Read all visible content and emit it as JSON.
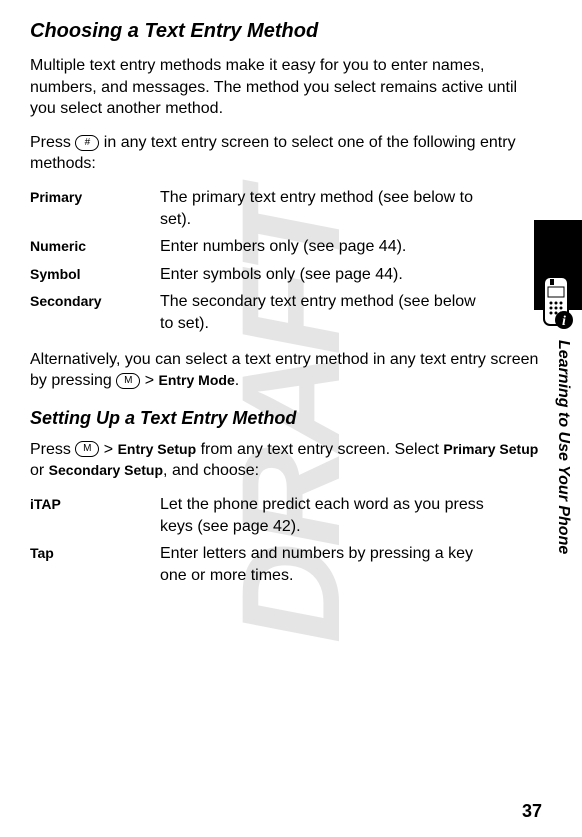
{
  "watermark": "DRAFT",
  "heading_main": "Choosing a Text Entry Method",
  "intro_para": "Multiple text entry methods make it easy for you to enter names, numbers, and messages. The method you select remains active until you select another method.",
  "press_para_pre": "Press ",
  "press_para_post": " in any text entry screen to select one of the following entry methods:",
  "methods": [
    {
      "label": "Primary",
      "desc": "The primary text entry method (see below to set)."
    },
    {
      "label": "Numeric",
      "desc": "Enter numbers only (see page 44)."
    },
    {
      "label": "Symbol",
      "desc": "Enter symbols only (see page 44)."
    },
    {
      "label": "Secondary",
      "desc": "The secondary text entry method (see below to set)."
    }
  ],
  "alt_para_pre": "Alternatively, you can select a text entry method in any text entry screen by pressing ",
  "alt_para_mid": " > ",
  "alt_menu": "Entry Mode",
  "alt_para_post": ".",
  "heading_setup": "Setting Up a Text Entry Method",
  "setup_para_pre": "Press ",
  "setup_para_mid1": " > ",
  "setup_menu1": "Entry Setup",
  "setup_para_mid2": " from any text entry screen. Select ",
  "setup_menu2": "Primary Setup",
  "setup_or": " or ",
  "setup_menu3": "Secondary Setup",
  "setup_para_post": ", and choose:",
  "setup_methods": [
    {
      "label": "iTAP",
      "desc": "Let the phone predict each word as you press keys (see page 42)."
    },
    {
      "label": "Tap",
      "desc": "Enter letters and numbers by pressing a key one or more times."
    }
  ],
  "side_label": "Learning to Use Your Phone",
  "page_number": "37",
  "key_hash": "#",
  "key_menu": "M"
}
